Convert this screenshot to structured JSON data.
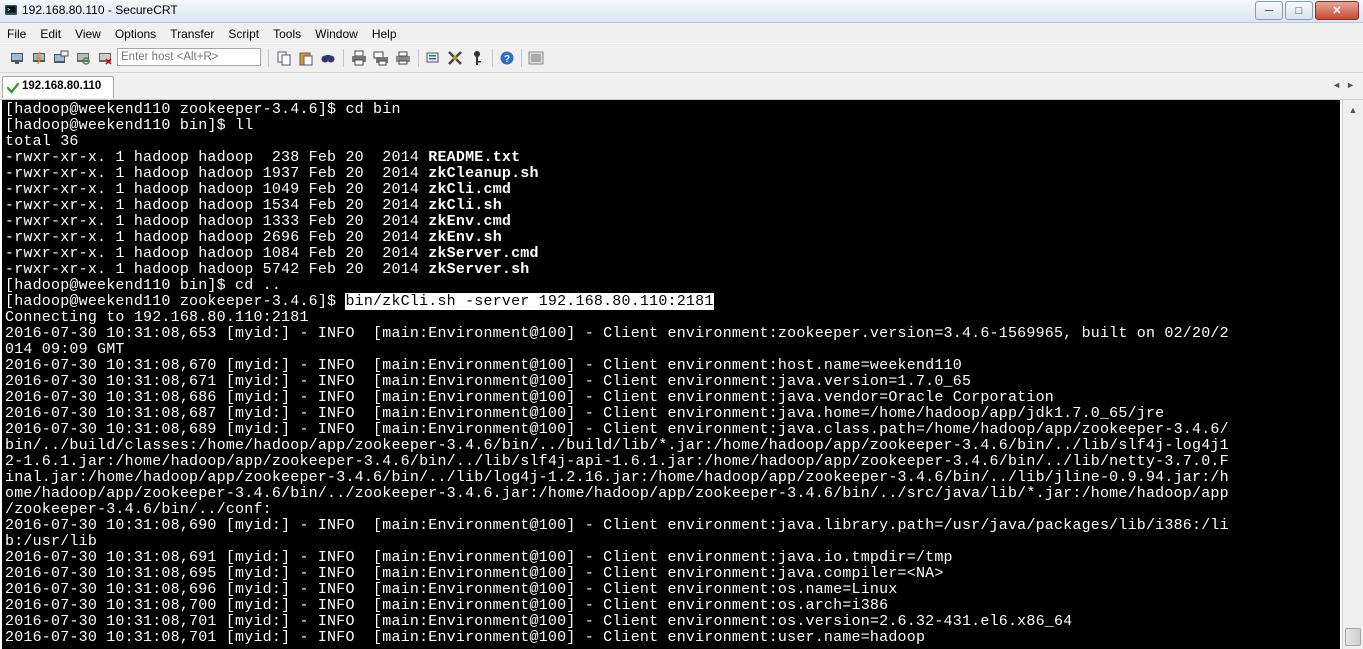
{
  "window": {
    "title": "192.168.80.110 - SecureCRT",
    "controls": {
      "minimize": "─",
      "maximize": "□",
      "close": "✕"
    }
  },
  "menu": [
    "File",
    "Edit",
    "View",
    "Options",
    "Transfer",
    "Script",
    "Tools",
    "Window",
    "Help"
  ],
  "toolbar": {
    "host_placeholder": "Enter host <Alt+R>",
    "icons": [
      "connect-icon",
      "quick-connect-icon",
      "connect-in-tab-icon",
      "reconnect-icon",
      "disconnect-icon",
      "copy-icon",
      "paste-icon",
      "find-icon",
      "print-icon",
      "print-selection-icon",
      "print-setup-icon",
      "session-options-icon",
      "global-options-icon",
      "keymap-icon",
      "help-icon",
      "sftp-icon"
    ]
  },
  "tab": {
    "label": "192.168.80.110",
    "status_icon": "check-icon",
    "nav_left": "◄",
    "nav_right": "►"
  },
  "scrollbar": {
    "up": "▲"
  },
  "terminal": {
    "colors": {
      "bg": "#000000",
      "fg": "#ffffff",
      "highlight_bg": "#ffffff",
      "highlight_fg": "#000000"
    },
    "lines": [
      {
        "text": "[hadoop@weekend110 zookeeper-3.4.6]$ cd bin"
      },
      {
        "text": "[hadoop@weekend110 bin]$ ll"
      },
      {
        "text": "total 36"
      },
      {
        "text": "-rwxr-xr-x. 1 hadoop hadoop  238 Feb 20  2014 ",
        "bold": "README.txt"
      },
      {
        "text": "-rwxr-xr-x. 1 hadoop hadoop 1937 Feb 20  2014 ",
        "bold": "zkCleanup.sh"
      },
      {
        "text": "-rwxr-xr-x. 1 hadoop hadoop 1049 Feb 20  2014 ",
        "bold": "zkCli.cmd"
      },
      {
        "text": "-rwxr-xr-x. 1 hadoop hadoop 1534 Feb 20  2014 ",
        "bold": "zkCli.sh"
      },
      {
        "text": "-rwxr-xr-x. 1 hadoop hadoop 1333 Feb 20  2014 ",
        "bold": "zkEnv.cmd"
      },
      {
        "text": "-rwxr-xr-x. 1 hadoop hadoop 2696 Feb 20  2014 ",
        "bold": "zkEnv.sh"
      },
      {
        "text": "-rwxr-xr-x. 1 hadoop hadoop 1084 Feb 20  2014 ",
        "bold": "zkServer.cmd"
      },
      {
        "text": "-rwxr-xr-x. 1 hadoop hadoop 5742 Feb 20  2014 ",
        "bold": "zkServer.sh"
      },
      {
        "text": "[hadoop@weekend110 bin]$ cd .."
      },
      {
        "text": "[hadoop@weekend110 zookeeper-3.4.6]$ ",
        "highlight": "bin/zkCli.sh -server 192.168.80.110:2181"
      },
      {
        "text": "Connecting to 192.168.80.110:2181"
      },
      {
        "text": "2016-07-30 10:31:08,653 [myid:] - INFO  [main:Environment@100] - Client environment:zookeeper.version=3.4.6-1569965, built on 02/20/2"
      },
      {
        "text": "014 09:09 GMT"
      },
      {
        "text": "2016-07-30 10:31:08,670 [myid:] - INFO  [main:Environment@100] - Client environment:host.name=weekend110"
      },
      {
        "text": "2016-07-30 10:31:08,671 [myid:] - INFO  [main:Environment@100] - Client environment:java.version=1.7.0_65"
      },
      {
        "text": "2016-07-30 10:31:08,686 [myid:] - INFO  [main:Environment@100] - Client environment:java.vendor=Oracle Corporation"
      },
      {
        "text": "2016-07-30 10:31:08,687 [myid:] - INFO  [main:Environment@100] - Client environment:java.home=/home/hadoop/app/jdk1.7.0_65/jre"
      },
      {
        "text": "2016-07-30 10:31:08,689 [myid:] - INFO  [main:Environment@100] - Client environment:java.class.path=/home/hadoop/app/zookeeper-3.4.6/"
      },
      {
        "text": "bin/../build/classes:/home/hadoop/app/zookeeper-3.4.6/bin/../build/lib/*.jar:/home/hadoop/app/zookeeper-3.4.6/bin/../lib/slf4j-log4j1"
      },
      {
        "text": "2-1.6.1.jar:/home/hadoop/app/zookeeper-3.4.6/bin/../lib/slf4j-api-1.6.1.jar:/home/hadoop/app/zookeeper-3.4.6/bin/../lib/netty-3.7.0.F"
      },
      {
        "text": "inal.jar:/home/hadoop/app/zookeeper-3.4.6/bin/../lib/log4j-1.2.16.jar:/home/hadoop/app/zookeeper-3.4.6/bin/../lib/jline-0.9.94.jar:/h"
      },
      {
        "text": "ome/hadoop/app/zookeeper-3.4.6/bin/../zookeeper-3.4.6.jar:/home/hadoop/app/zookeeper-3.4.6/bin/../src/java/lib/*.jar:/home/hadoop/app"
      },
      {
        "text": "/zookeeper-3.4.6/bin/../conf:"
      },
      {
        "text": "2016-07-30 10:31:08,690 [myid:] - INFO  [main:Environment@100] - Client environment:java.library.path=/usr/java/packages/lib/i386:/li"
      },
      {
        "text": "b:/usr/lib"
      },
      {
        "text": "2016-07-30 10:31:08,691 [myid:] - INFO  [main:Environment@100] - Client environment:java.io.tmpdir=/tmp"
      },
      {
        "text": "2016-07-30 10:31:08,695 [myid:] - INFO  [main:Environment@100] - Client environment:java.compiler=<NA>"
      },
      {
        "text": "2016-07-30 10:31:08,696 [myid:] - INFO  [main:Environment@100] - Client environment:os.name=Linux"
      },
      {
        "text": "2016-07-30 10:31:08,700 [myid:] - INFO  [main:Environment@100] - Client environment:os.arch=i386"
      },
      {
        "text": "2016-07-30 10:31:08,701 [myid:] - INFO  [main:Environment@100] - Client environment:os.version=2.6.32-431.el6.x86_64"
      },
      {
        "text": "2016-07-30 10:31:08,701 [myid:] - INFO  [main:Environment@100] - Client environment:user.name=hadoop"
      }
    ]
  }
}
